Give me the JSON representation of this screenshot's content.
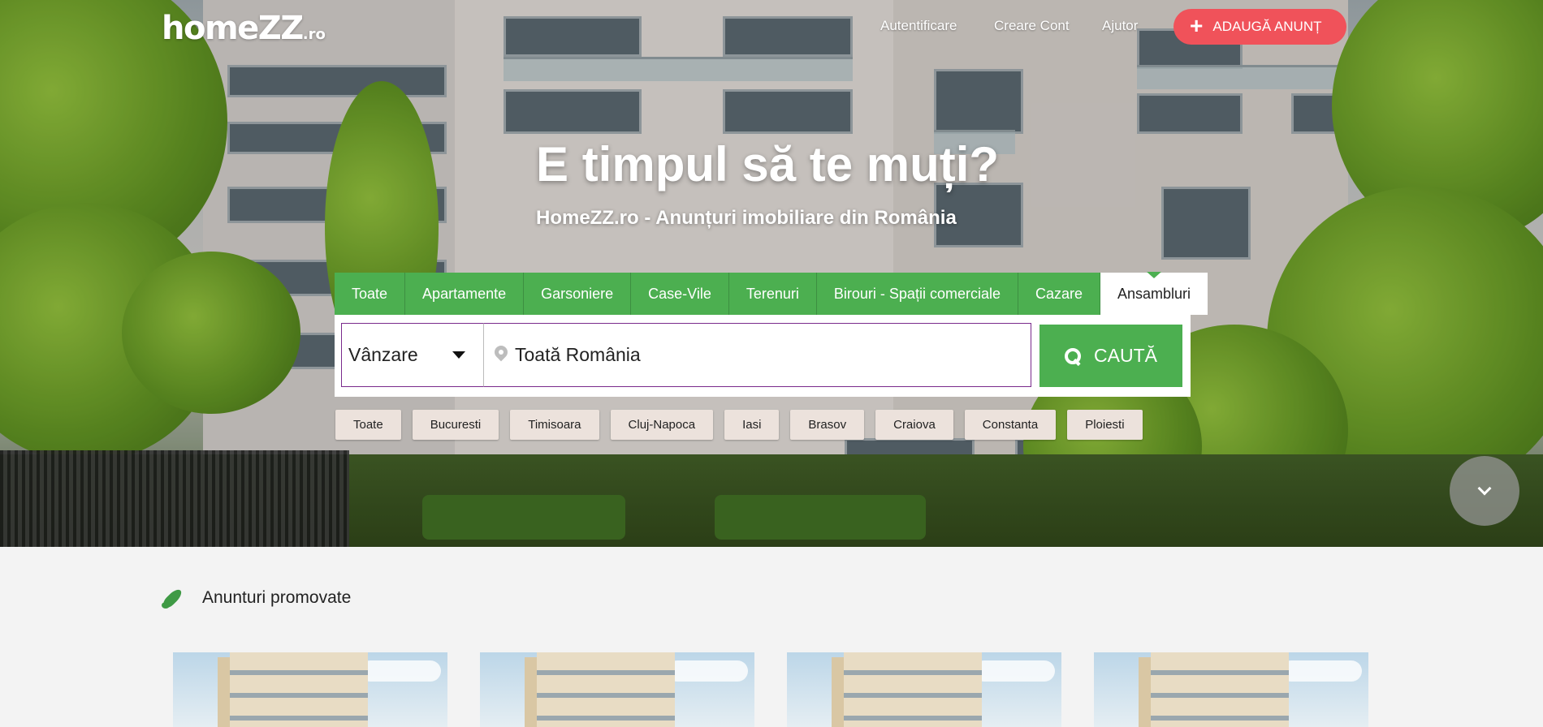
{
  "header": {
    "logo_main": "homeZZ",
    "logo_tld": ".ro",
    "nav": {
      "login": "Autentificare",
      "signup": "Creare Cont",
      "help": "Ajutor"
    },
    "add_button": {
      "icon": "+",
      "label": "ADAUGĂ ANUNȚ"
    }
  },
  "hero": {
    "title": "E timpul să te muți?",
    "subtitle": "HomeZZ.ro - Anunțuri imobiliare din România"
  },
  "search": {
    "tabs": [
      {
        "label": "Toate"
      },
      {
        "label": "Apartamente"
      },
      {
        "label": "Garsoniere"
      },
      {
        "label": "Case-Vile"
      },
      {
        "label": "Terenuri"
      },
      {
        "label": "Birouri - Spații comerciale"
      },
      {
        "label": "Cazare"
      },
      {
        "label": "Ansambluri"
      }
    ],
    "active_tab": "Ansambluri",
    "type_select": "Vânzare",
    "location_value": "Toată România",
    "button_label": "CAUTĂ",
    "cities": [
      "Toate",
      "Bucuresti",
      "Timisoara",
      "Cluj-Napoca",
      "Iasi",
      "Brasov",
      "Craiova",
      "Constanta",
      "Ploiesti"
    ]
  },
  "promoted": {
    "title": "Anunturi promovate"
  },
  "colors": {
    "brand_green": "#4caf50",
    "accent_red": "#f0525a",
    "chip_bg": "#ece2dc",
    "page_bg": "#f3f3f3"
  },
  "icons": {
    "add": "plus-icon",
    "location": "map-pin-icon",
    "search": "magnifier-icon",
    "scroll": "chevron-down-icon",
    "promoted": "rocket-icon"
  }
}
